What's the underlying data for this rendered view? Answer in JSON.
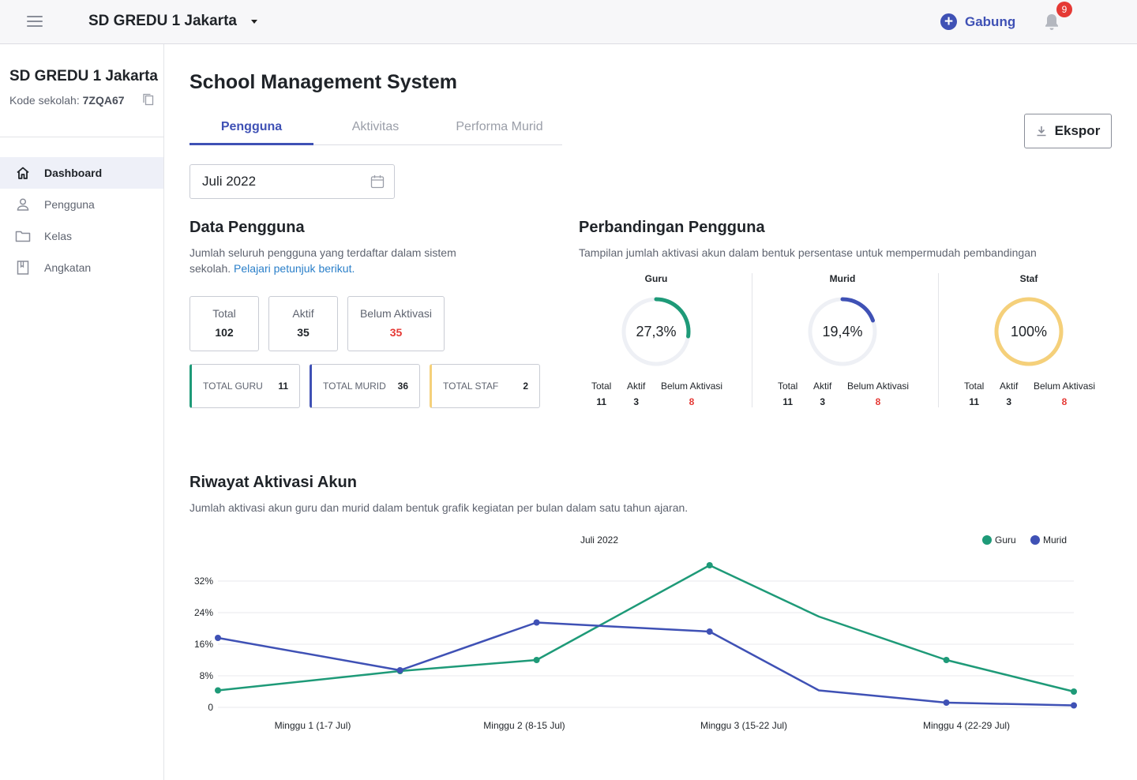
{
  "topbar": {
    "school_name": "SD GREDU 1 Jakarta",
    "join_label": "Gabung",
    "notification_count": "9"
  },
  "sidebar": {
    "school_name": "SD GREDU 1 Jakarta",
    "code_label": "Kode sekolah: ",
    "code_value": "7ZQA67",
    "items": [
      {
        "label": "Dashboard",
        "icon": "home-icon",
        "active": true
      },
      {
        "label": "Pengguna",
        "icon": "user-icon",
        "active": false
      },
      {
        "label": "Kelas",
        "icon": "folder-icon",
        "active": false
      },
      {
        "label": "Angkatan",
        "icon": "book-icon",
        "active": false
      }
    ]
  },
  "main": {
    "title": "School Management System",
    "tabs": [
      "Pengguna",
      "Aktivitas",
      "Performa Murid"
    ],
    "export_label": "Ekspor",
    "date_value": "Juli 2022"
  },
  "data_pengguna": {
    "title": "Data Pengguna",
    "desc": "Jumlah seluruh pengguna yang terdaftar dalam sistem sekolah.",
    "link": "Pelajari petunjuk berikut.",
    "stats": [
      {
        "label": "Total",
        "value": "102"
      },
      {
        "label": "Aktif",
        "value": "35"
      },
      {
        "label": "Belum Aktivasi",
        "value": "35"
      }
    ],
    "roles": [
      {
        "label": "TOTAL GURU",
        "value": "11",
        "color": "#1e9a78"
      },
      {
        "label": "TOTAL MURID",
        "value": "36",
        "color": "#3f51b5"
      },
      {
        "label": "TOTAL STAF",
        "value": "2",
        "color": "#f5d07a"
      }
    ]
  },
  "perbandingan": {
    "title": "Perbandingan Pengguna",
    "desc": "Tampilan jumlah aktivasi akun dalam bentuk persentase untuk mempermudah pembandingan",
    "groups": [
      {
        "role": "Guru",
        "percent_text": "27,3%",
        "fraction": 0.273,
        "color": "#1e9a78",
        "total_label": "Total",
        "total": "11",
        "aktif_label": "Aktif",
        "aktif": "3",
        "belum_label": "Belum Aktivasi",
        "belum": "8"
      },
      {
        "role": "Murid",
        "percent_text": "19,4%",
        "fraction": 0.194,
        "color": "#3f51b5",
        "total_label": "Total",
        "total": "11",
        "aktif_label": "Aktif",
        "aktif": "3",
        "belum_label": "Belum Aktivasi",
        "belum": "8"
      },
      {
        "role": "Staf",
        "percent_text": "100%",
        "fraction": 1.0,
        "color": "#f5d07a",
        "total_label": "Total",
        "total": "11",
        "aktif_label": "Aktif",
        "aktif": "3",
        "belum_label": "Belum Aktivasi",
        "belum": "8"
      }
    ]
  },
  "riwayat": {
    "title": "Riwayat Aktivasi Akun",
    "desc": "Jumlah aktivasi akun guru dan murid dalam bentuk grafik kegiatan per bulan dalam satu tahun ajaran."
  },
  "chart_data": {
    "type": "line",
    "title": "Juli 2022",
    "xlabel": "",
    "ylabel": "",
    "ylim": [
      0,
      36
    ],
    "y_ticks": [
      0,
      8,
      16,
      24,
      32
    ],
    "y_tick_labels": [
      "0",
      "8%",
      "16%",
      "24%",
      "32%"
    ],
    "categories": [
      "Minggu 1 (1-7 Jul)",
      "Minggu 2 (8-15 Jul)",
      "Minggu 3 (15-22 Jul)",
      "Minggu 4 (22-29 Jul)"
    ],
    "x": [
      0,
      1,
      1.75,
      2.7,
      3.3,
      4.0,
      4.7
    ],
    "legend_position": "top-right",
    "grid": true,
    "series": [
      {
        "name": "Guru",
        "color": "#1e9a78",
        "values": [
          4.3,
          9.2,
          12.0,
          36.0,
          23.0,
          12.0,
          4.0
        ]
      },
      {
        "name": "Murid",
        "color": "#3f51b5",
        "values": [
          17.6,
          9.4,
          21.5,
          19.2,
          4.3,
          1.2,
          0.5
        ]
      }
    ]
  }
}
